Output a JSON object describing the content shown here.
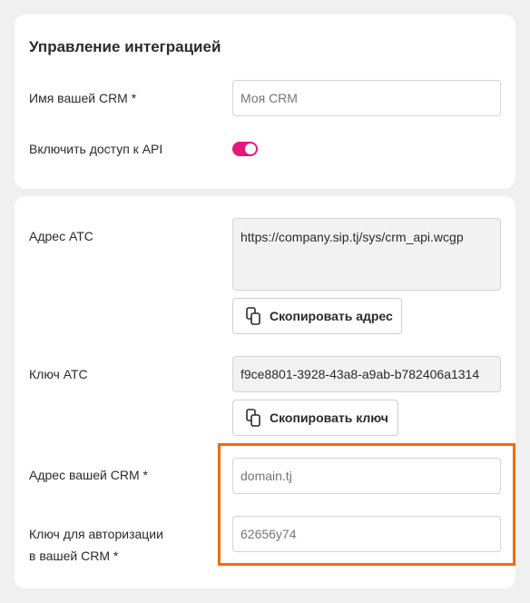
{
  "integration": {
    "title": "Управление интеграцией",
    "crm_name_label": "Имя вашей CRM *",
    "crm_name_placeholder": "Моя CRM",
    "api_access_label": "Включить доступ к API",
    "api_access_enabled": true,
    "toggle_color": "#e5197c"
  },
  "pbx": {
    "address_label": "Адрес АТС",
    "address_value": "https://company.sip.tj/sys/crm_api.wcgp",
    "copy_address_label": "Скопировать адрес",
    "key_label": "Ключ АТС",
    "key_value": "f9ce8801-3928-43a8-a9ab-b782406a1314",
    "copy_key_label": "Скопировать ключ"
  },
  "crm": {
    "address_label": "Адрес вашей CRM *",
    "address_placeholder": "domain.tj",
    "auth_key_label_line1": "Ключ для авторизации",
    "auth_key_label_line2": "в вашей CRM *",
    "auth_key_placeholder": "62656y74"
  },
  "colors": {
    "accent": "#e5197c",
    "highlight": "#f26b10"
  },
  "icons": {
    "copy": "copy-icon"
  }
}
